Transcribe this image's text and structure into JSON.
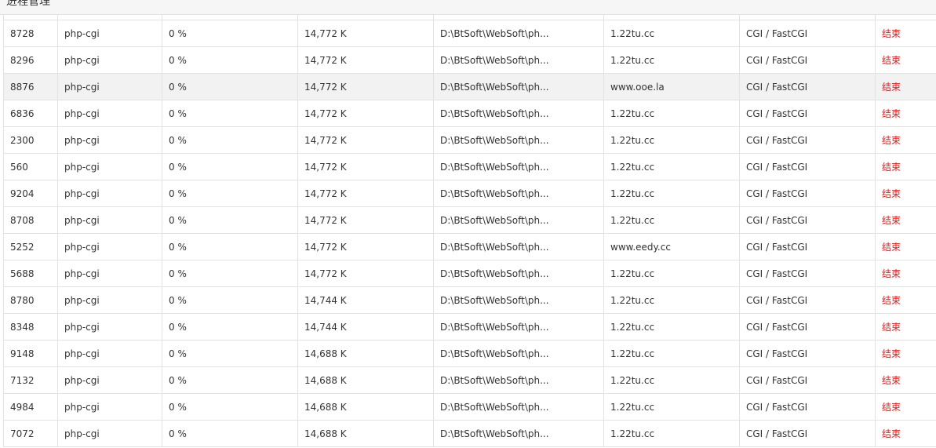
{
  "title": "进程管理",
  "rows": [
    {
      "pid": "8728",
      "name": "php-cgi",
      "cpu": "0 %",
      "mem": "14,772 K",
      "path": "D:\\BtSoft\\WebSoft\\ph...",
      "site": "1.22tu.cc",
      "type": "CGI / FastCGI",
      "action": "结束"
    },
    {
      "pid": "8296",
      "name": "php-cgi",
      "cpu": "0 %",
      "mem": "14,772 K",
      "path": "D:\\BtSoft\\WebSoft\\ph...",
      "site": "1.22tu.cc",
      "type": "CGI / FastCGI",
      "action": "结束"
    },
    {
      "pid": "8876",
      "name": "php-cgi",
      "cpu": "0 %",
      "mem": "14,772 K",
      "path": "D:\\BtSoft\\WebSoft\\ph...",
      "site": "www.ooe.la",
      "type": "CGI / FastCGI",
      "action": "结束",
      "highlight": true
    },
    {
      "pid": "6836",
      "name": "php-cgi",
      "cpu": "0 %",
      "mem": "14,772 K",
      "path": "D:\\BtSoft\\WebSoft\\ph...",
      "site": "1.22tu.cc",
      "type": "CGI / FastCGI",
      "action": "结束"
    },
    {
      "pid": "2300",
      "name": "php-cgi",
      "cpu": "0 %",
      "mem": "14,772 K",
      "path": "D:\\BtSoft\\WebSoft\\ph...",
      "site": "1.22tu.cc",
      "type": "CGI / FastCGI",
      "action": "结束"
    },
    {
      "pid": "560",
      "name": "php-cgi",
      "cpu": "0 %",
      "mem": "14,772 K",
      "path": "D:\\BtSoft\\WebSoft\\ph...",
      "site": "1.22tu.cc",
      "type": "CGI / FastCGI",
      "action": "结束"
    },
    {
      "pid": "9204",
      "name": "php-cgi",
      "cpu": "0 %",
      "mem": "14,772 K",
      "path": "D:\\BtSoft\\WebSoft\\ph...",
      "site": "1.22tu.cc",
      "type": "CGI / FastCGI",
      "action": "结束"
    },
    {
      "pid": "8708",
      "name": "php-cgi",
      "cpu": "0 %",
      "mem": "14,772 K",
      "path": "D:\\BtSoft\\WebSoft\\ph...",
      "site": "1.22tu.cc",
      "type": "CGI / FastCGI",
      "action": "结束"
    },
    {
      "pid": "5252",
      "name": "php-cgi",
      "cpu": "0 %",
      "mem": "14,772 K",
      "path": "D:\\BtSoft\\WebSoft\\ph...",
      "site": "www.eedy.cc",
      "type": "CGI / FastCGI",
      "action": "结束"
    },
    {
      "pid": "5688",
      "name": "php-cgi",
      "cpu": "0 %",
      "mem": "14,772 K",
      "path": "D:\\BtSoft\\WebSoft\\ph...",
      "site": "1.22tu.cc",
      "type": "CGI / FastCGI",
      "action": "结束"
    },
    {
      "pid": "8780",
      "name": "php-cgi",
      "cpu": "0 %",
      "mem": "14,744 K",
      "path": "D:\\BtSoft\\WebSoft\\ph...",
      "site": "1.22tu.cc",
      "type": "CGI / FastCGI",
      "action": "结束"
    },
    {
      "pid": "8348",
      "name": "php-cgi",
      "cpu": "0 %",
      "mem": "14,744 K",
      "path": "D:\\BtSoft\\WebSoft\\ph...",
      "site": "1.22tu.cc",
      "type": "CGI / FastCGI",
      "action": "结束"
    },
    {
      "pid": "9148",
      "name": "php-cgi",
      "cpu": "0 %",
      "mem": "14,688 K",
      "path": "D:\\BtSoft\\WebSoft\\ph...",
      "site": "1.22tu.cc",
      "type": "CGI / FastCGI",
      "action": "结束"
    },
    {
      "pid": "7132",
      "name": "php-cgi",
      "cpu": "0 %",
      "mem": "14,688 K",
      "path": "D:\\BtSoft\\WebSoft\\ph...",
      "site": "1.22tu.cc",
      "type": "CGI / FastCGI",
      "action": "结束"
    },
    {
      "pid": "4984",
      "name": "php-cgi",
      "cpu": "0 %",
      "mem": "14,688 K",
      "path": "D:\\BtSoft\\WebSoft\\ph...",
      "site": "1.22tu.cc",
      "type": "CGI / FastCGI",
      "action": "结束"
    },
    {
      "pid": "7072",
      "name": "php-cgi",
      "cpu": "0 %",
      "mem": "14,688 K",
      "path": "D:\\BtSoft\\WebSoft\\ph...",
      "site": "1.22tu.cc",
      "type": "CGI / FastCGI",
      "action": "结束"
    }
  ],
  "colors": {
    "action": "#e02020",
    "highlight_row": "#f2f2f2",
    "border": "#e2e2e2"
  }
}
